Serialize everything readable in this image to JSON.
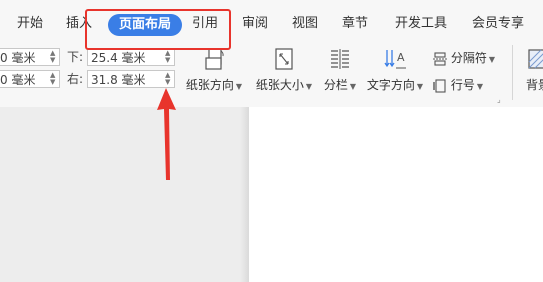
{
  "tabs": [
    "开始",
    "插入",
    "页面布局",
    "引用",
    "审阅",
    "视图",
    "章节",
    "开发工具",
    "会员专享"
  ],
  "active_tab": "页面布局",
  "margins": {
    "top_value": "0 毫米",
    "left_value": "0 毫米",
    "bottom_label": "下:",
    "bottom_value": "25.4 毫米",
    "right_label": "右:",
    "right_value": "31.8 毫米"
  },
  "tools": {
    "orientation": "纸张方向",
    "size": "纸张大小",
    "columns": "分栏",
    "text_direction": "文字方向",
    "separator": "分隔符",
    "line_number": "行号",
    "background": "背景"
  },
  "colors": {
    "accent": "#3a7ee6",
    "annotation": "#e8342c"
  }
}
